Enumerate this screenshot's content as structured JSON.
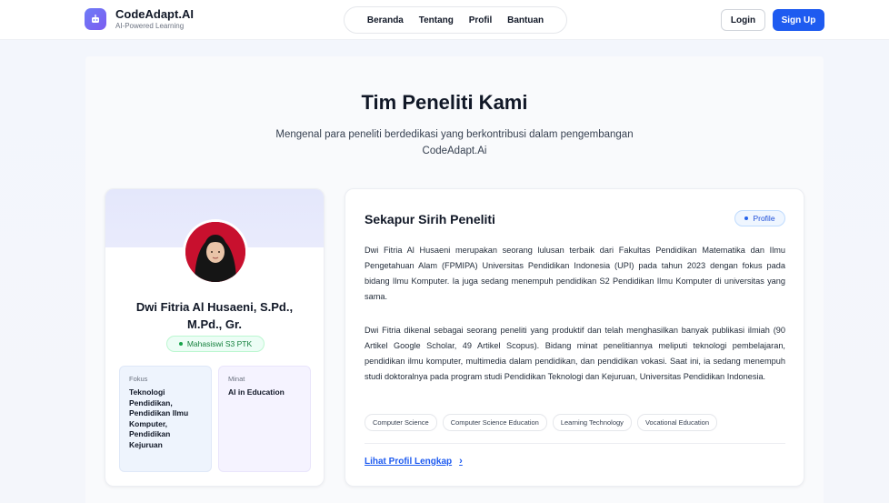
{
  "brand": {
    "name": "CodeAdapt.AI",
    "tagline": "AI-Powered Learning"
  },
  "nav": {
    "items": [
      "Beranda",
      "Tentang",
      "Profil",
      "Bantuan"
    ]
  },
  "auth": {
    "login_label": "Login",
    "signup_label": "Sign Up"
  },
  "hero": {
    "title": "Tim Peneliti Kami",
    "subtitle": "Mengenal para peneliti berdedikasi yang berkontribusi dalam pengembangan CodeAdapt.Ai"
  },
  "profile": {
    "name": "Dwi Fitria Al Husaeni, S.Pd., M.Pd., Gr.",
    "badge": "Mahasiswi S3 PTK",
    "fokus_label": "Fokus",
    "fokus_value": "Teknologi Pendidikan, Pendidikan Ilmu Komputer, Pendidikan Kejuruan",
    "minat_label": "Minat",
    "minat_value": "AI in Education"
  },
  "intro": {
    "title": "Sekapur Sirih Peneliti",
    "badge": "Profile",
    "paragraph1": "Dwi Fitria Al Husaeni merupakan seorang lulusan terbaik dari Fakultas Pendidikan Matematika dan Ilmu Pengetahuan Alam (FPMIPA) Universitas Pendidikan Indonesia (UPI) pada tahun 2023 dengan fokus pada bidang Ilmu Komputer. Ia juga sedang menempuh pendidikan S2 Pendidikan Ilmu Komputer di universitas yang sama.",
    "paragraph2": "Dwi Fitria dikenal sebagai seorang peneliti yang produktif dan telah menghasilkan banyak publikasi ilmiah (90 Artikel Google Scholar, 49 Artikel Scopus). Bidang minat penelitiannya meliputi teknologi pembelajaran, pendidikan ilmu komputer, multimedia dalam pendidikan, dan pendidikan vokasi. Saat ini, ia sedang menempuh studi doktoralnya pada program studi Pendidikan Teknologi dan Kejuruan, Universitas Pendidikan Indonesia.",
    "tags": [
      "Computer Science",
      "Computer Science Education",
      "Learning Technology",
      "Vocational Education"
    ],
    "more_label": "Lihat Profil Lengkap"
  },
  "colors": {
    "primary": "#1e5bf0",
    "accent_purple": "#7c5cf0",
    "success": "#16a34a"
  }
}
